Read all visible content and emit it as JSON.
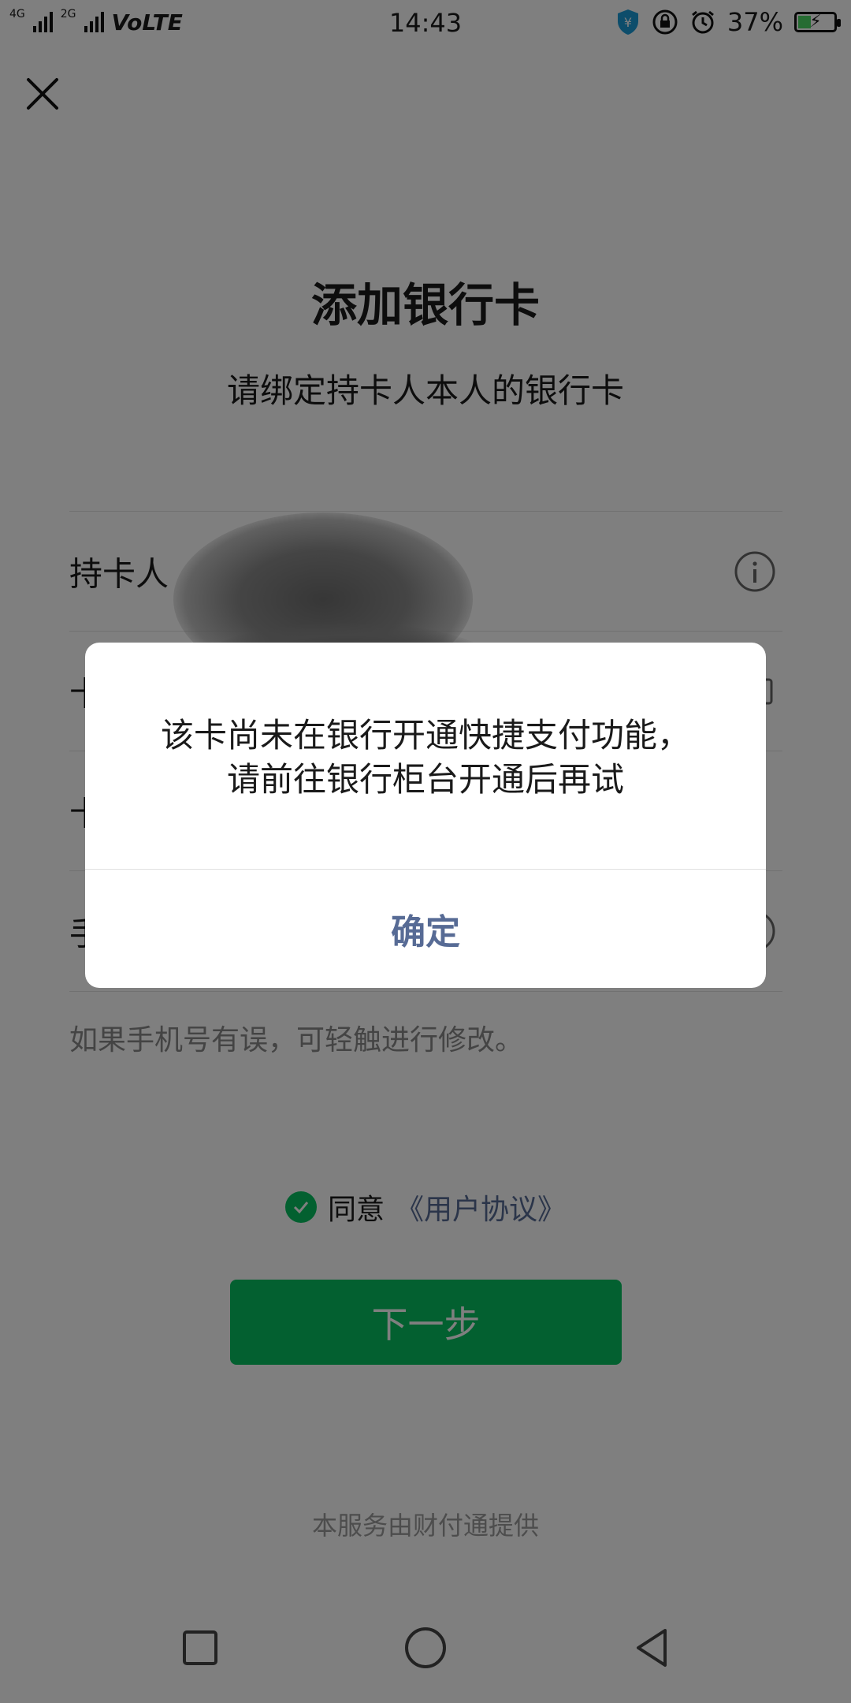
{
  "status_bar": {
    "network_1": "4G",
    "network_2": "2G",
    "volte": "VoLTE",
    "time": "14:43",
    "battery": "37%",
    "battery_level": 0.37
  },
  "page": {
    "title": "添加银行卡",
    "subtitle": "请绑定持卡人本人的银行卡",
    "fields": [
      {
        "label": "持卡人",
        "icon": "info-icon"
      },
      {
        "label": "卡",
        "icon": "card-icon"
      },
      {
        "label": "卡",
        "icon": ""
      },
      {
        "label": "手",
        "icon": "clear-icon"
      }
    ],
    "hint": "如果手机号有误，可轻触进行修改。",
    "agree_prefix": "同意",
    "agree_link": "《用户协议》",
    "next_button": "下一步",
    "provider": "本服务由财付通提供"
  },
  "dialog": {
    "message_line1": "该卡尚未在银行开通快捷支付功能，",
    "message_line2": "请前往银行柜台开通后再试",
    "confirm_button": "确定"
  },
  "colors": {
    "wechat_green": "#07c160",
    "link_blue": "#576b95",
    "mask": "rgba(0,0,0,0.5)"
  },
  "nav_icons": [
    "recent-apps-icon",
    "home-icon",
    "back-icon"
  ]
}
